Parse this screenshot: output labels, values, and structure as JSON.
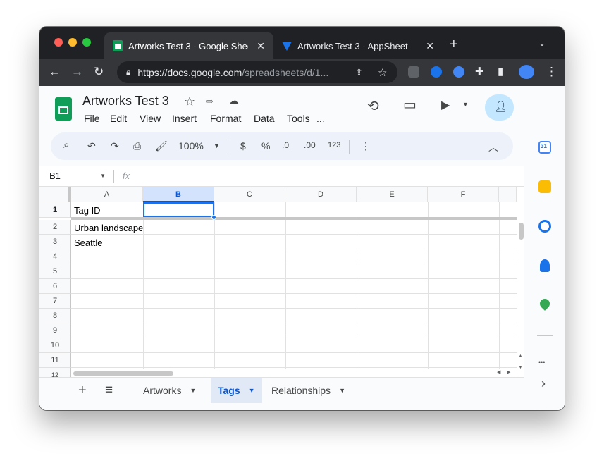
{
  "browser": {
    "tabs": [
      {
        "title": "Artworks Test 3 - Google Sheets",
        "icon": "sheets-icon",
        "close": "✕"
      },
      {
        "title": "Artworks Test 3 - AppSheet",
        "icon": "appsheet-icon",
        "close": "✕"
      }
    ],
    "new_tab": "+",
    "tab_menu": "⌄",
    "url_host": "https://docs.google.com",
    "url_path": "/spreadsheets/d/1..."
  },
  "sheets": {
    "title": "Artworks Test 3",
    "menu": [
      "File",
      "Edit",
      "View",
      "Insert",
      "Format",
      "Data",
      "Tools",
      "..."
    ],
    "zoom": "100%",
    "currency": "$",
    "percent": "%",
    "decrease_decimals": ".0",
    "increase_decimals": ".00",
    "more_formats": "123",
    "name_box": "B1",
    "fx": "fx",
    "columns": [
      "A",
      "B",
      "C",
      "D",
      "E",
      "F"
    ],
    "rows": [
      "1",
      "2",
      "3",
      "4",
      "5",
      "6",
      "7",
      "8",
      "9",
      "10",
      "11",
      "12"
    ],
    "cells": {
      "A1": "Tag ID",
      "A2": "Urban landscape",
      "A3": "Seattle"
    },
    "selected_cell": "B1",
    "sheet_tabs": [
      "Artworks",
      "Tags",
      "Relationships"
    ],
    "active_sheet": "Tags",
    "add_sheet": "+",
    "all_sheets": "≡"
  },
  "side_panel": {
    "calendar_day": "31",
    "more": "•••",
    "expand": "›"
  },
  "colors": {
    "accent": "#0b57d0",
    "selection": "#1a73e8",
    "sheets_green": "#0f9d58",
    "share_bg": "#c2e7ff"
  }
}
